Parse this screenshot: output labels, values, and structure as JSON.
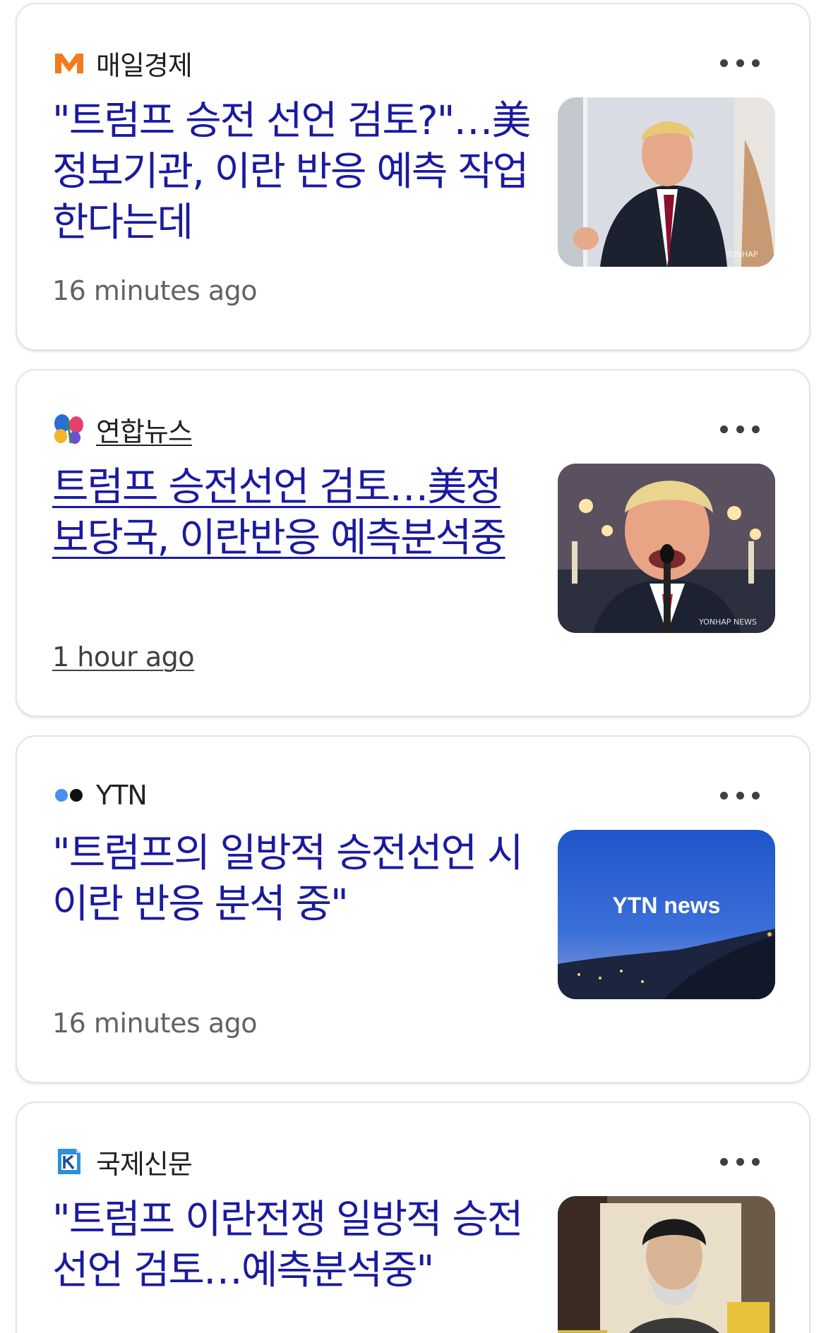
{
  "articles": [
    {
      "source": "매일경제",
      "source_logo": "maeil-m-logo",
      "headline": "\"트럼프 승전 선언 검토?\"…美 정보기관, 이란 반응 예측 작업한다는데",
      "time": "16 minutes ago",
      "thumbnail_watermark": "YONHAP"
    },
    {
      "source": "연합뉴스",
      "source_logo": "yonhap-butterfly-logo",
      "headline": "트럼프 승전선언 검토…美정보당국, 이란반응 예측분석중",
      "time": "1 hour ago",
      "thumbnail_watermark": "YONHAP NEWS"
    },
    {
      "source": "YTN",
      "source_logo": "ytn-dots-logo",
      "headline": "\"트럼프의 일방적 승전선언 시 이란 반응 분석 중\"",
      "time": "16 minutes ago",
      "thumbnail_text": "YTN news"
    },
    {
      "source": "국제신문",
      "source_logo": "kookje-k-logo",
      "headline": "\"트럼프 이란전쟁 일방적 승전선언 검토…예측분석중\"",
      "time": ""
    }
  ],
  "colors": {
    "headline": "#1a1aa0",
    "meta": "#5f6368",
    "card_border": "#e3e3e8"
  }
}
